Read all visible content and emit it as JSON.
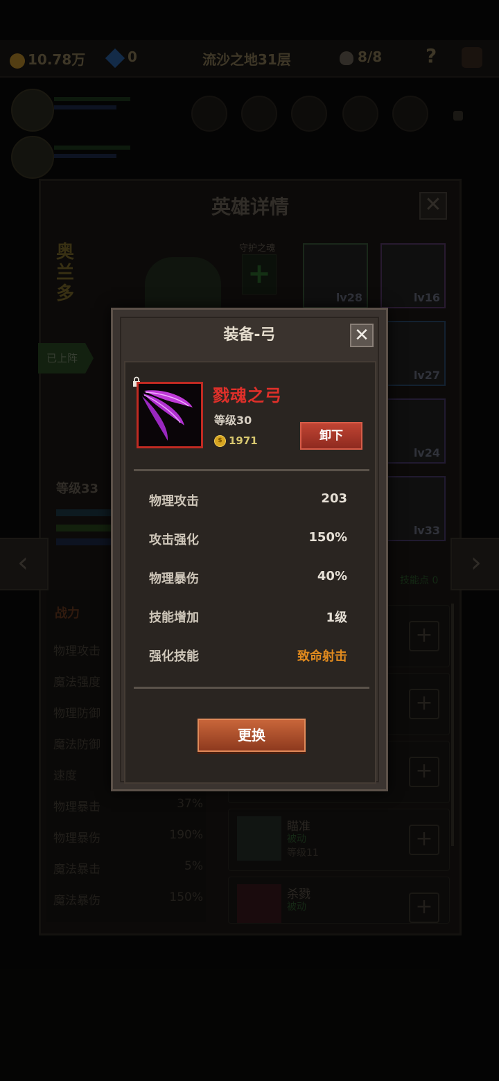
{
  "top_bar": {
    "gold": "10.78万",
    "gems": "0",
    "stage": "流沙之地31层",
    "team": "8/8",
    "help": "?"
  },
  "hero_panel": {
    "title": "英雄详情",
    "close": "✕",
    "hero_name": "奥兰多",
    "guard_label": "守护之魂",
    "deployed_label": "已上阵",
    "level": "等级33",
    "skill_points": "技能点 0",
    "stats_header": "战力",
    "stats": [
      {
        "label": "物理攻击",
        "value": ""
      },
      {
        "label": "魔法强度",
        "value": ""
      },
      {
        "label": "物理防御",
        "value": ""
      },
      {
        "label": "魔法防御",
        "value": ""
      },
      {
        "label": "速度",
        "value": ""
      },
      {
        "label": "物理暴击",
        "value": "37%"
      },
      {
        "label": "物理暴伤",
        "value": "190%"
      },
      {
        "label": "魔法暴击",
        "value": "5%"
      },
      {
        "label": "魔法暴伤",
        "value": "150%"
      }
    ],
    "equipment": [
      {
        "lv": "lv28"
      },
      {
        "lv": "lv16"
      },
      {
        "lv": "lv27"
      },
      {
        "lv": "lv24"
      },
      {
        "lv": "lv33"
      }
    ],
    "skills": [
      {
        "name": "瞄准",
        "type": "被动",
        "level": "等级11"
      },
      {
        "name": "杀戮",
        "type": "被动",
        "level": ""
      }
    ]
  },
  "modal": {
    "title": "装备-弓",
    "close": "✕",
    "item_name": "戮魂之弓",
    "item_level": "等级30",
    "price": "1971",
    "coin_symbol": "$",
    "unequip_label": "卸下",
    "attributes": [
      {
        "label": "物理攻击",
        "value": "203"
      },
      {
        "label": "攻击强化",
        "value": "150%"
      },
      {
        "label": "物理暴伤",
        "value": "40%"
      },
      {
        "label": "技能增加",
        "value": "1级"
      },
      {
        "label": "强化技能",
        "value": "致命射击"
      }
    ],
    "change_label": "更换"
  },
  "colors": {
    "item_name": "#e0302a",
    "highlight_skill": "#e08a1e",
    "item_border": "#c02a22"
  },
  "icons": {
    "nav_prev": "‹",
    "nav_next": "›",
    "plus": "+"
  }
}
